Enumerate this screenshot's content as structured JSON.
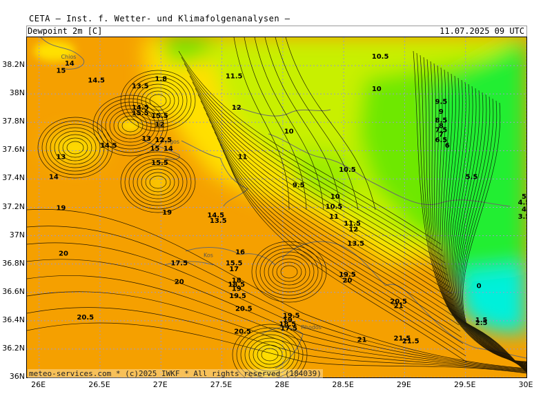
{
  "header": {
    "provider": "CETA — Inst. f. Wetter- und Klimafolgenanalysen —",
    "parameter": "Dewpoint 2m [C]",
    "valid_time": "11.07.2025 09 UTC"
  },
  "footer": {
    "copyright": "meteo-services.com * (c)2025 IWKF * All rights reserved (184039)"
  },
  "axes": {
    "lat_labels": [
      "38.2N",
      "38N",
      "37.8N",
      "37.6N",
      "37.4N",
      "37.2N",
      "37N",
      "36.8N",
      "36.6N",
      "36.4N",
      "36.2N",
      "36N"
    ],
    "lon_labels": [
      "26E",
      "26.5E",
      "27E",
      "27.5E",
      "28E",
      "28.5E",
      "29E",
      "29.5E",
      "30E"
    ]
  },
  "place_names": [
    "Chios",
    "Pyrgos",
    "Kos",
    "Rhodos"
  ],
  "colors": {
    "orange": "#F5A000",
    "yellow": "#FFE000",
    "yellow_green": "#C8F000",
    "green": "#6EE800",
    "bright_green": "#22EE33",
    "cyan": "#00F0DA",
    "contour": "#000000",
    "grid": "#9999cc"
  },
  "contour_labels": [
    {
      "text": "14",
      "lon": 26.25,
      "lat": 38.2
    },
    {
      "text": "15",
      "lon": 26.18,
      "lat": 38.15
    },
    {
      "text": "14.5",
      "lon": 26.47,
      "lat": 38.08
    },
    {
      "text": "13.5",
      "lon": 26.83,
      "lat": 38.04
    },
    {
      "text": "14.5",
      "lon": 26.83,
      "lat": 37.89
    },
    {
      "text": "15.5",
      "lon": 26.83,
      "lat": 37.85
    },
    {
      "text": "13",
      "lon": 26.88,
      "lat": 37.67
    },
    {
      "text": "14.5",
      "lon": 26.57,
      "lat": 37.62
    },
    {
      "text": "12.5",
      "lon": 27.02,
      "lat": 37.66
    },
    {
      "text": "14",
      "lon": 27.06,
      "lat": 37.6
    },
    {
      "text": "13",
      "lon": 26.18,
      "lat": 37.54
    },
    {
      "text": "14",
      "lon": 26.12,
      "lat": 37.4
    },
    {
      "text": "19",
      "lon": 26.18,
      "lat": 37.18
    },
    {
      "text": "19",
      "lon": 27.05,
      "lat": 37.15
    },
    {
      "text": "14.5",
      "lon": 27.45,
      "lat": 37.13
    },
    {
      "text": "13.5",
      "lon": 27.47,
      "lat": 37.09
    },
    {
      "text": "11.5",
      "lon": 27.6,
      "lat": 38.11
    },
    {
      "text": "12",
      "lon": 27.62,
      "lat": 37.89
    },
    {
      "text": "10",
      "lon": 28.05,
      "lat": 37.72
    },
    {
      "text": "11",
      "lon": 27.67,
      "lat": 37.54
    },
    {
      "text": "10.5",
      "lon": 28.8,
      "lat": 38.25
    },
    {
      "text": "10",
      "lon": 28.77,
      "lat": 38.02
    },
    {
      "text": "10.5",
      "lon": 28.53,
      "lat": 37.45
    },
    {
      "text": "9.5",
      "lon": 28.13,
      "lat": 37.34
    },
    {
      "text": "10",
      "lon": 28.43,
      "lat": 37.26
    },
    {
      "text": "10.5",
      "lon": 28.42,
      "lat": 37.19
    },
    {
      "text": "11",
      "lon": 28.42,
      "lat": 37.12
    },
    {
      "text": "9.5",
      "lon": 29.3,
      "lat": 37.93
    },
    {
      "text": "9",
      "lon": 29.3,
      "lat": 37.86
    },
    {
      "text": "8.5",
      "lon": 29.3,
      "lat": 37.8
    },
    {
      "text": "8",
      "lon": 29.3,
      "lat": 37.76
    },
    {
      "text": "7.5",
      "lon": 29.3,
      "lat": 37.73
    },
    {
      "text": "7",
      "lon": 29.3,
      "lat": 37.7
    },
    {
      "text": "6.5",
      "lon": 29.3,
      "lat": 37.66
    },
    {
      "text": "6",
      "lon": 29.35,
      "lat": 37.62
    },
    {
      "text": "5.5",
      "lon": 29.55,
      "lat": 37.4
    },
    {
      "text": "5",
      "lon": 29.98,
      "lat": 37.26
    },
    {
      "text": "4.5",
      "lon": 29.98,
      "lat": 37.22
    },
    {
      "text": "4",
      "lon": 29.98,
      "lat": 37.17
    },
    {
      "text": "3.5",
      "lon": 29.98,
      "lat": 37.12
    },
    {
      "text": "11.5",
      "lon": 28.57,
      "lat": 37.07
    },
    {
      "text": "12",
      "lon": 28.58,
      "lat": 37.03
    },
    {
      "text": "20",
      "lon": 26.2,
      "lat": 36.86
    },
    {
      "text": "16",
      "lon": 27.65,
      "lat": 36.87
    },
    {
      "text": "17.5",
      "lon": 27.15,
      "lat": 36.79
    },
    {
      "text": "15.5",
      "lon": 27.6,
      "lat": 36.79
    },
    {
      "text": "17",
      "lon": 27.6,
      "lat": 36.75
    },
    {
      "text": "20",
      "lon": 27.15,
      "lat": 36.66
    },
    {
      "text": "18",
      "lon": 27.62,
      "lat": 36.67
    },
    {
      "text": "18.5",
      "lon": 27.62,
      "lat": 36.64
    },
    {
      "text": "19",
      "lon": 27.62,
      "lat": 36.61
    },
    {
      "text": "19.5",
      "lon": 27.63,
      "lat": 36.56
    },
    {
      "text": "20.5",
      "lon": 27.68,
      "lat": 36.47
    },
    {
      "text": "19.5",
      "lon": 28.07,
      "lat": 36.42
    },
    {
      "text": "19",
      "lon": 28.04,
      "lat": 36.39
    },
    {
      "text": "18.5",
      "lon": 28.04,
      "lat": 36.36
    },
    {
      "text": "17.5",
      "lon": 28.05,
      "lat": 36.33
    },
    {
      "text": "20.5",
      "lon": 26.38,
      "lat": 36.41
    },
    {
      "text": "20.5",
      "lon": 27.67,
      "lat": 36.31
    },
    {
      "text": "19.5",
      "lon": 28.53,
      "lat": 36.71
    },
    {
      "text": "20",
      "lon": 28.53,
      "lat": 36.67
    },
    {
      "text": "20.5",
      "lon": 28.95,
      "lat": 36.52
    },
    {
      "text": "21",
      "lon": 28.95,
      "lat": 36.49
    },
    {
      "text": "21",
      "lon": 28.65,
      "lat": 36.25
    },
    {
      "text": "21.5",
      "lon": 28.98,
      "lat": 36.26
    },
    {
      "text": "21.5",
      "lon": 29.05,
      "lat": 36.24
    },
    {
      "text": "0",
      "lon": 29.61,
      "lat": 36.63
    },
    {
      "text": "1.5",
      "lon": 29.63,
      "lat": 36.39
    },
    {
      "text": "2.5",
      "lon": 29.63,
      "lat": 36.37
    },
    {
      "text": "1.8",
      "lon": 27.0,
      "lat": 38.09
    },
    {
      "text": "12",
      "lon": 26.99,
      "lat": 37.77
    },
    {
      "text": "15.5",
      "lon": 26.99,
      "lat": 37.83
    },
    {
      "text": "15",
      "lon": 26.95,
      "lat": 37.6
    },
    {
      "text": "15.5",
      "lon": 26.99,
      "lat": 37.5
    },
    {
      "text": "13.5",
      "lon": 28.6,
      "lat": 36.93
    }
  ]
}
